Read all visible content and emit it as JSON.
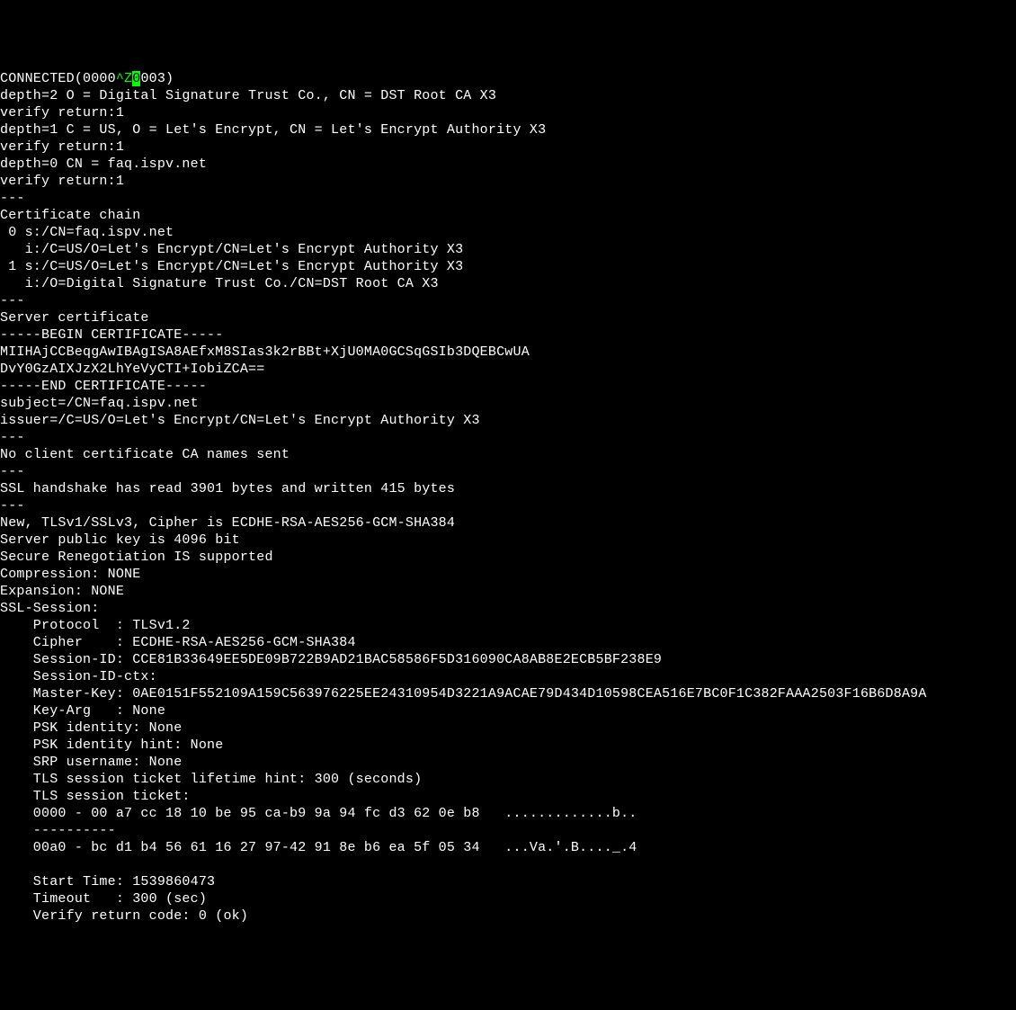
{
  "terminal": {
    "conn_prefix": "CONNECTED(0000",
    "ctrl": "^Z",
    "cursor_char": "0",
    "conn_suffix": "003)",
    "lines": [
      "depth=2 O = Digital Signature Trust Co., CN = DST Root CA X3",
      "verify return:1",
      "depth=1 C = US, O = Let's Encrypt, CN = Let's Encrypt Authority X3",
      "verify return:1",
      "depth=0 CN = faq.ispv.net",
      "verify return:1",
      "---",
      "Certificate chain",
      " 0 s:/CN=faq.ispv.net",
      "   i:/C=US/O=Let's Encrypt/CN=Let's Encrypt Authority X3",
      " 1 s:/C=US/O=Let's Encrypt/CN=Let's Encrypt Authority X3",
      "   i:/O=Digital Signature Trust Co./CN=DST Root CA X3",
      "---",
      "Server certificate",
      "-----BEGIN CERTIFICATE-----",
      "MIIHAjCCBeqgAwIBAgISA8AEfxM8SIas3k2rBBt+XjU0MA0GCSqGSIb3DQEBCwUA",
      "DvY0GzAIXJzX2LhYeVyCTI+IobiZCA==",
      "-----END CERTIFICATE-----",
      "subject=/CN=faq.ispv.net",
      "issuer=/C=US/O=Let's Encrypt/CN=Let's Encrypt Authority X3",
      "---",
      "No client certificate CA names sent",
      "---",
      "SSL handshake has read 3901 bytes and written 415 bytes",
      "---",
      "New, TLSv1/SSLv3, Cipher is ECDHE-RSA-AES256-GCM-SHA384",
      "Server public key is 4096 bit",
      "Secure Renegotiation IS supported",
      "Compression: NONE",
      "Expansion: NONE",
      "SSL-Session:",
      "    Protocol  : TLSv1.2",
      "    Cipher    : ECDHE-RSA-AES256-GCM-SHA384",
      "    Session-ID: CCE81B33649EE5DE09B722B9AD21BAC58586F5D316090CA8AB8E2ECB5BF238E9",
      "    Session-ID-ctx:",
      "    Master-Key: 0AE0151F552109A159C563976225EE24310954D3221A9ACAE79D434D10598CEA516E7BC0F1C382FAAA2503F16B6D8A9A",
      "    Key-Arg   : None",
      "    PSK identity: None",
      "    PSK identity hint: None",
      "    SRP username: None",
      "    TLS session ticket lifetime hint: 300 (seconds)",
      "    TLS session ticket:",
      "    0000 - 00 a7 cc 18 10 be 95 ca-b9 9a 94 fc d3 62 0e b8   .............b..",
      "    ----------",
      "    00a0 - bc d1 b4 56 61 16 27 97-42 91 8e b6 ea 5f 05 34   ...Va.'.B...._.4",
      "",
      "    Start Time: 1539860473",
      "    Timeout   : 300 (sec)",
      "    Verify return code: 0 (ok)"
    ]
  }
}
